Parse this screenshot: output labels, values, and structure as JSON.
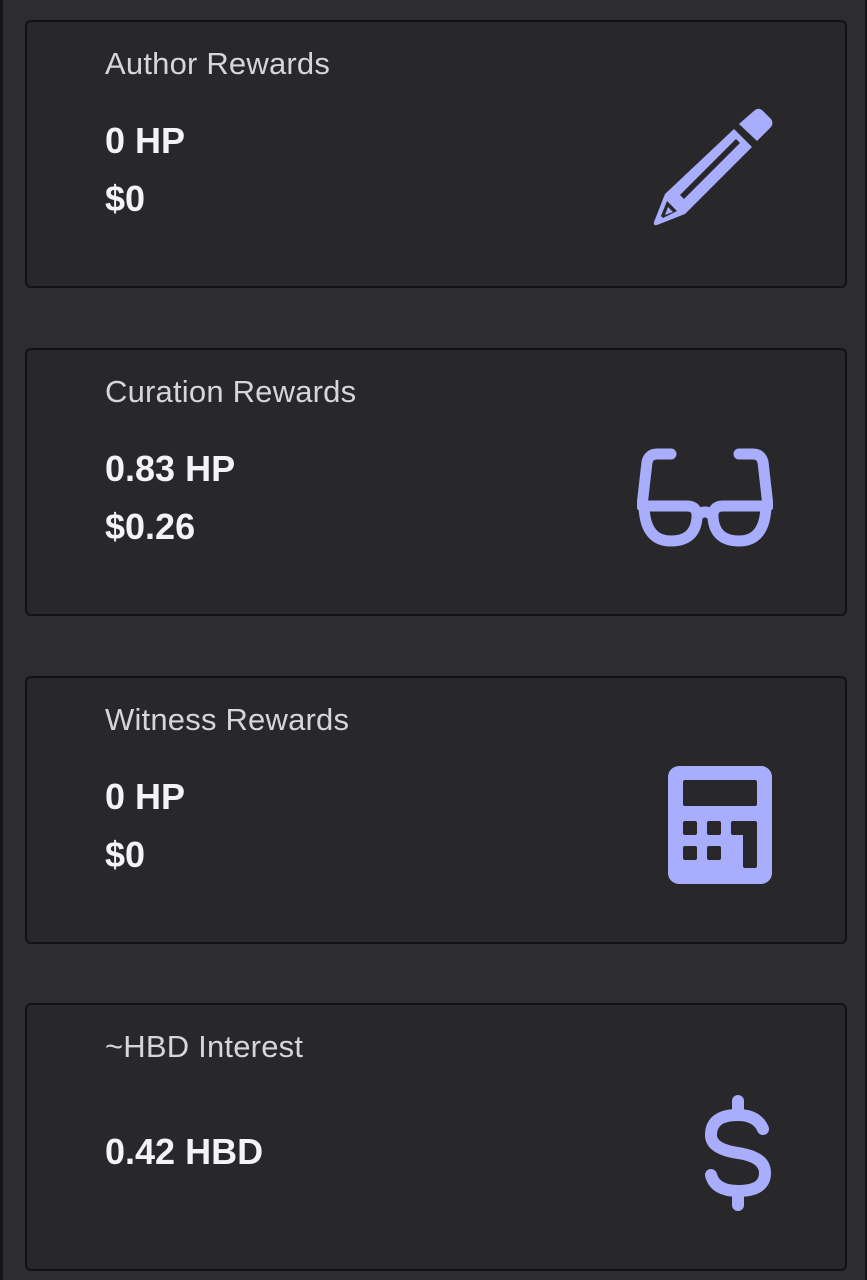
{
  "accent_color": "#a9aefc",
  "cards": [
    {
      "title": "Author Rewards",
      "hp": "0 HP",
      "usd": "$0",
      "icon": "pencil-icon"
    },
    {
      "title": "Curation Rewards",
      "hp": "0.83 HP",
      "usd": "$0.26",
      "icon": "glasses-icon"
    },
    {
      "title": "Witness Rewards",
      "hp": "0 HP",
      "usd": "$0",
      "icon": "calculator-icon"
    },
    {
      "title": "~HBD Interest",
      "hbd": "0.42 HBD",
      "icon": "dollar-icon"
    }
  ]
}
